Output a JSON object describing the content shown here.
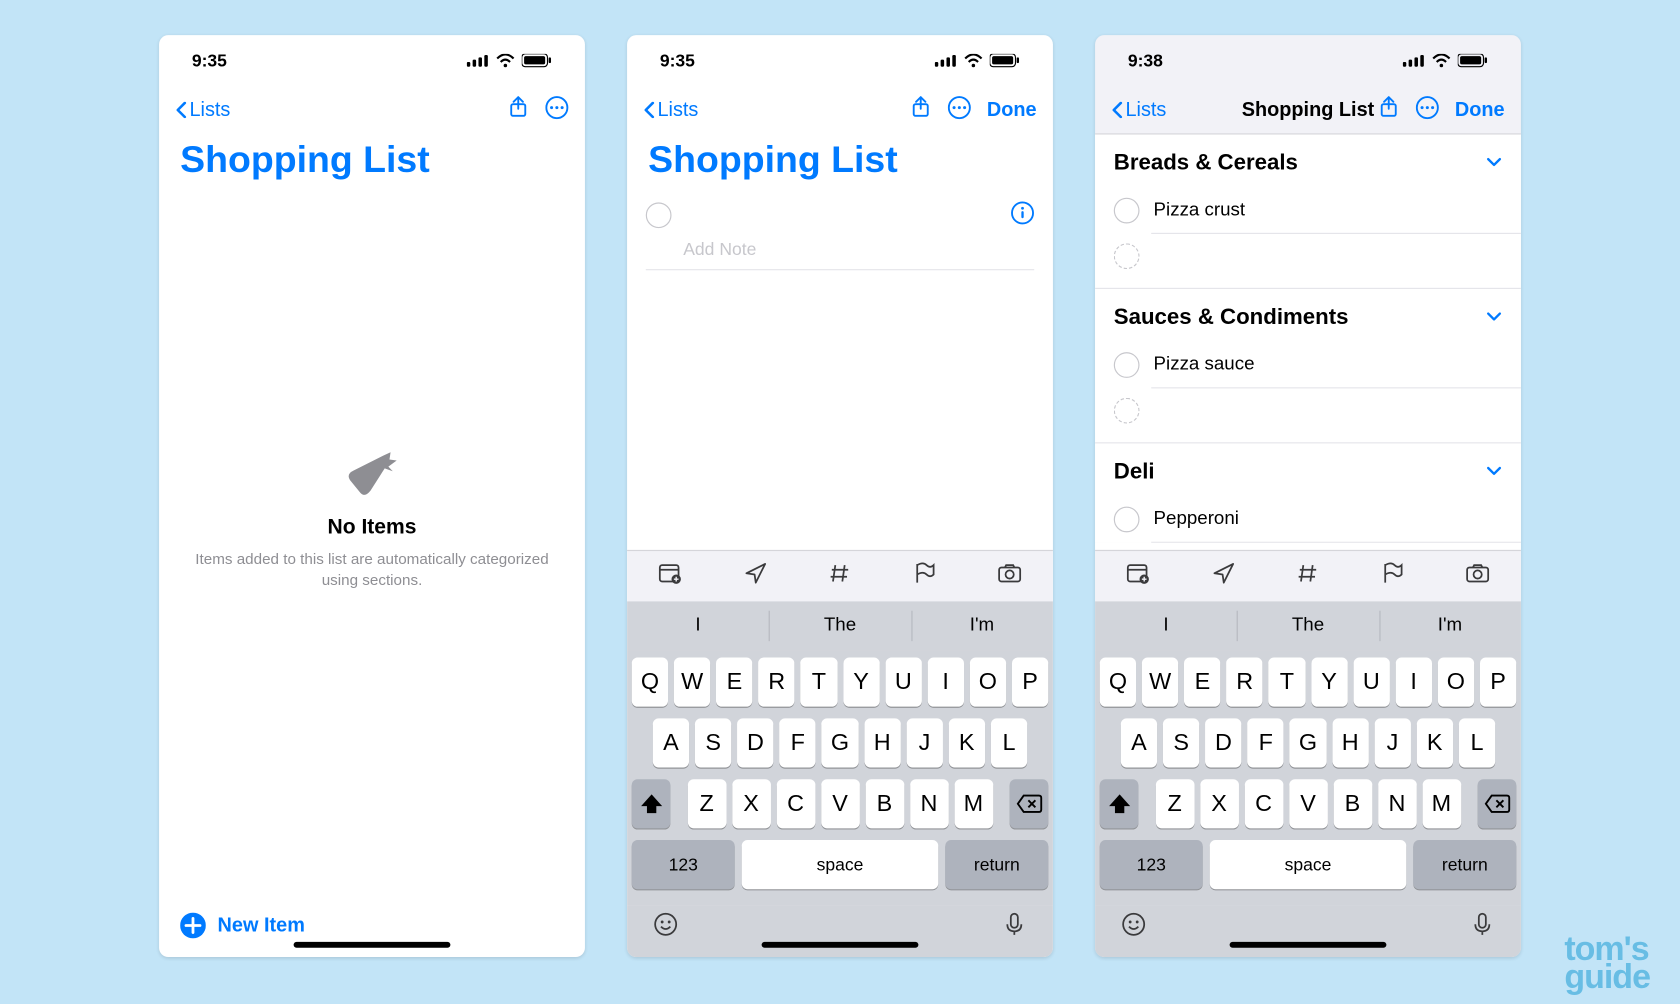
{
  "screens": {
    "s1": {
      "time": "9:35",
      "back": "Lists",
      "title": "Shopping List",
      "empty_title": "No Items",
      "empty_sub": "Items added to this list are automatically categorized using sections.",
      "new_item": "New Item"
    },
    "s2": {
      "time": "9:35",
      "back": "Lists",
      "done": "Done",
      "title": "Shopping List",
      "note_placeholder": "Add Note"
    },
    "s3": {
      "time": "9:38",
      "back": "Lists",
      "done": "Done",
      "title_small": "Shopping List",
      "sections": [
        {
          "name": "Breads & Cereals",
          "items": [
            "Pizza crust"
          ]
        },
        {
          "name": "Sauces & Condiments",
          "items": [
            "Pizza sauce"
          ]
        },
        {
          "name": "Deli",
          "items": [
            "Pepperoni"
          ]
        }
      ]
    }
  },
  "keyboard": {
    "toolbar_icons": [
      "calendar",
      "location",
      "hash",
      "flag",
      "camera"
    ],
    "suggestions": [
      "I",
      "The",
      "I'm"
    ],
    "row1": [
      "Q",
      "W",
      "E",
      "R",
      "T",
      "Y",
      "U",
      "I",
      "O",
      "P"
    ],
    "row2": [
      "A",
      "S",
      "D",
      "F",
      "G",
      "H",
      "J",
      "K",
      "L"
    ],
    "row3": [
      "Z",
      "X",
      "C",
      "V",
      "B",
      "N",
      "M"
    ],
    "k123": "123",
    "space": "space",
    "ret": "return"
  },
  "watermark_line1": "tom's",
  "watermark_line2": "guide"
}
